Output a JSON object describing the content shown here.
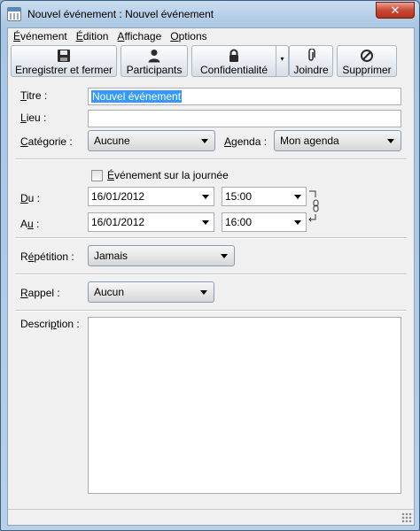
{
  "window": {
    "title": "Nouvel événement : Nouvel événement",
    "close_label": "✕"
  },
  "menu": {
    "items": [
      {
        "pre": "",
        "key": "É",
        "post": "vénement"
      },
      {
        "pre": "",
        "key": "É",
        "post": "dition"
      },
      {
        "pre": "",
        "key": "A",
        "post": "ffichage"
      },
      {
        "pre": "",
        "key": "O",
        "post": "ptions"
      }
    ]
  },
  "toolbar": {
    "save_close": "Enregistrer et fermer",
    "attendees": "Participants",
    "privacy": "Confidentialité",
    "privacy_arrow": "▾",
    "attach": "Joindre",
    "delete": "Supprimer",
    "icons": [
      "floppy-disk-icon",
      "person-icon",
      "padlock-icon",
      "paperclip-icon",
      "delete-circle-icon"
    ]
  },
  "form": {
    "title_label_key": "T",
    "title_label_rest": "itre :",
    "title_value": "Nouvel événement",
    "location_label_key": "L",
    "location_label_rest": "ieu :",
    "location_value": "",
    "category_label_key": "C",
    "category_label_rest": "atégorie :",
    "category_value": "Aucune",
    "calendar_label_key": "A",
    "calendar_label_rest": "genda :",
    "calendar_value": "Mon agenda",
    "allday_key": "É",
    "allday_rest": "vénement sur la journée",
    "allday_checked": false,
    "from_label_key": "D",
    "from_label_rest": "u :",
    "from_date": "16/01/2012",
    "from_time": "15:00",
    "to_label_rest_pre": "A",
    "to_label_key": "u",
    "to_label_rest": " :",
    "to_date": "16/01/2012",
    "to_time": "16:00",
    "repeat_label_pre": "R",
    "repeat_label_key": "é",
    "repeat_label_rest": "pétition :",
    "repeat_value": "Jamais",
    "reminder_label_key": "R",
    "reminder_label_rest": "appel :",
    "reminder_value": "Aucun",
    "description_label_pre": "Descri",
    "description_label_key": "p",
    "description_label_rest": "tion :",
    "description_value": ""
  },
  "colors": {
    "selection": "#3399ff",
    "close_button": "#c94a35",
    "window_frame": "#a9c6e3"
  }
}
